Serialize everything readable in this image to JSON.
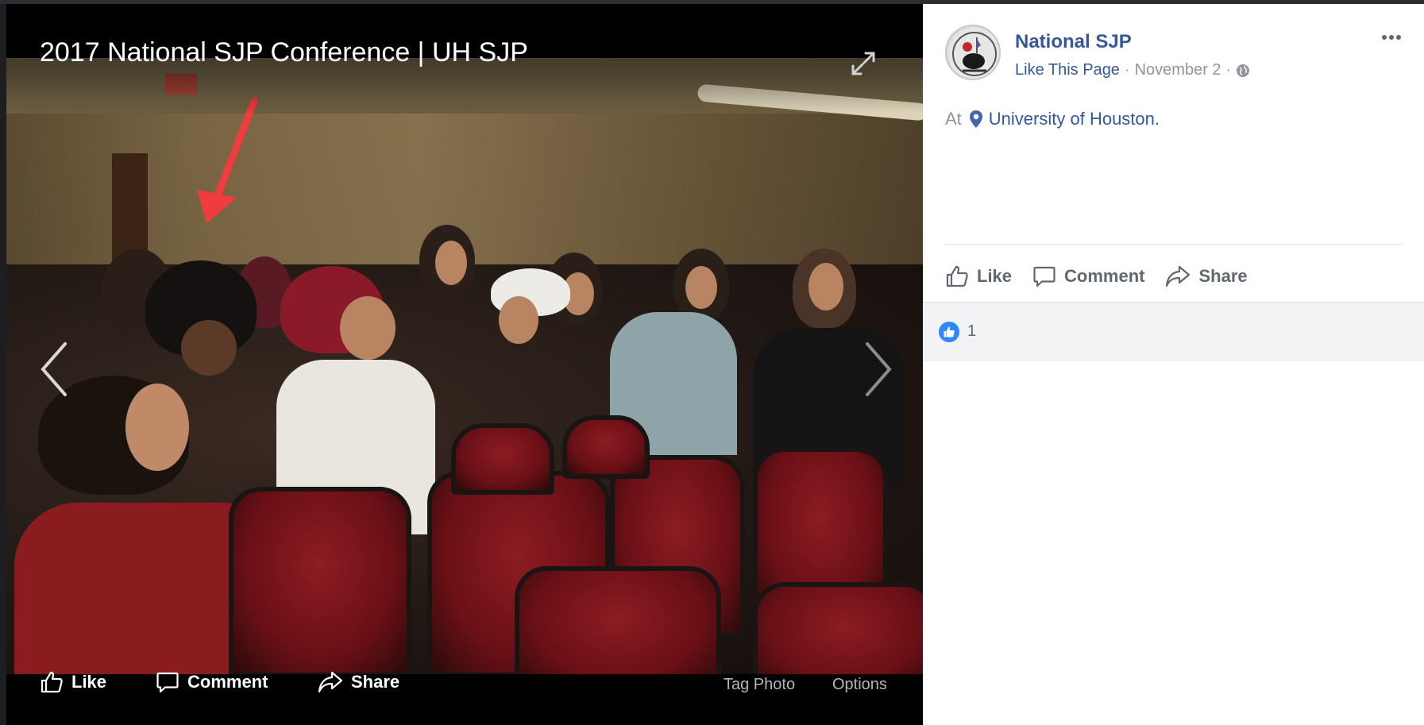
{
  "viewer": {
    "title": "2017 National SJP Conference | UH SJP",
    "actions": {
      "like": "Like",
      "comment": "Comment",
      "share": "Share",
      "tag_photo": "Tag Photo",
      "options": "Options"
    }
  },
  "post": {
    "page_name": "National SJP",
    "like_page": "Like This Page",
    "date": "November 2",
    "separator": "·",
    "location_prefix": "At",
    "location": "University of Houston.",
    "actions": {
      "like": "Like",
      "comment": "Comment",
      "share": "Share"
    },
    "reaction_count": "1"
  },
  "colors": {
    "link": "#365899",
    "muted": "#90949c",
    "like_blue": "#2d88ff",
    "arrow_red": "#f03c3c"
  },
  "icons": [
    "expand-icon",
    "chevron-left-icon",
    "chevron-right-icon",
    "thumbs-up-icon",
    "comment-icon",
    "share-icon",
    "more-icon",
    "globe-icon",
    "map-pin-icon"
  ]
}
